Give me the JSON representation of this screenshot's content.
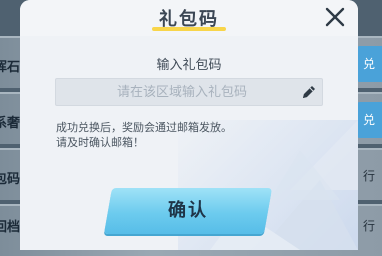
{
  "background": {
    "rows": [
      {
        "label": "挥石",
        "right": "兑",
        "right_style": "blue"
      },
      {
        "label": "系奢",
        "right": "兑",
        "right_style": "blue"
      },
      {
        "label": "包码",
        "right": "行",
        "right_style": "dim"
      },
      {
        "label": "回档",
        "right": "行",
        "right_style": "dim"
      }
    ]
  },
  "dialog": {
    "title": "礼包码",
    "close_icon": "close-icon",
    "field_label": "输入礼包码",
    "input": {
      "value": "",
      "placeholder": "请在该区域输入礼包码",
      "icon": "pencil-icon"
    },
    "note_line1": "成功兑换后，奖励会通过邮箱发放。",
    "note_line2": "请及时确认邮箱！",
    "confirm_label": "确认"
  },
  "colors": {
    "title_underline": "#f8d54a",
    "confirm_button": "#6ccbee",
    "dialog_bg": "#f3f5f8"
  }
}
